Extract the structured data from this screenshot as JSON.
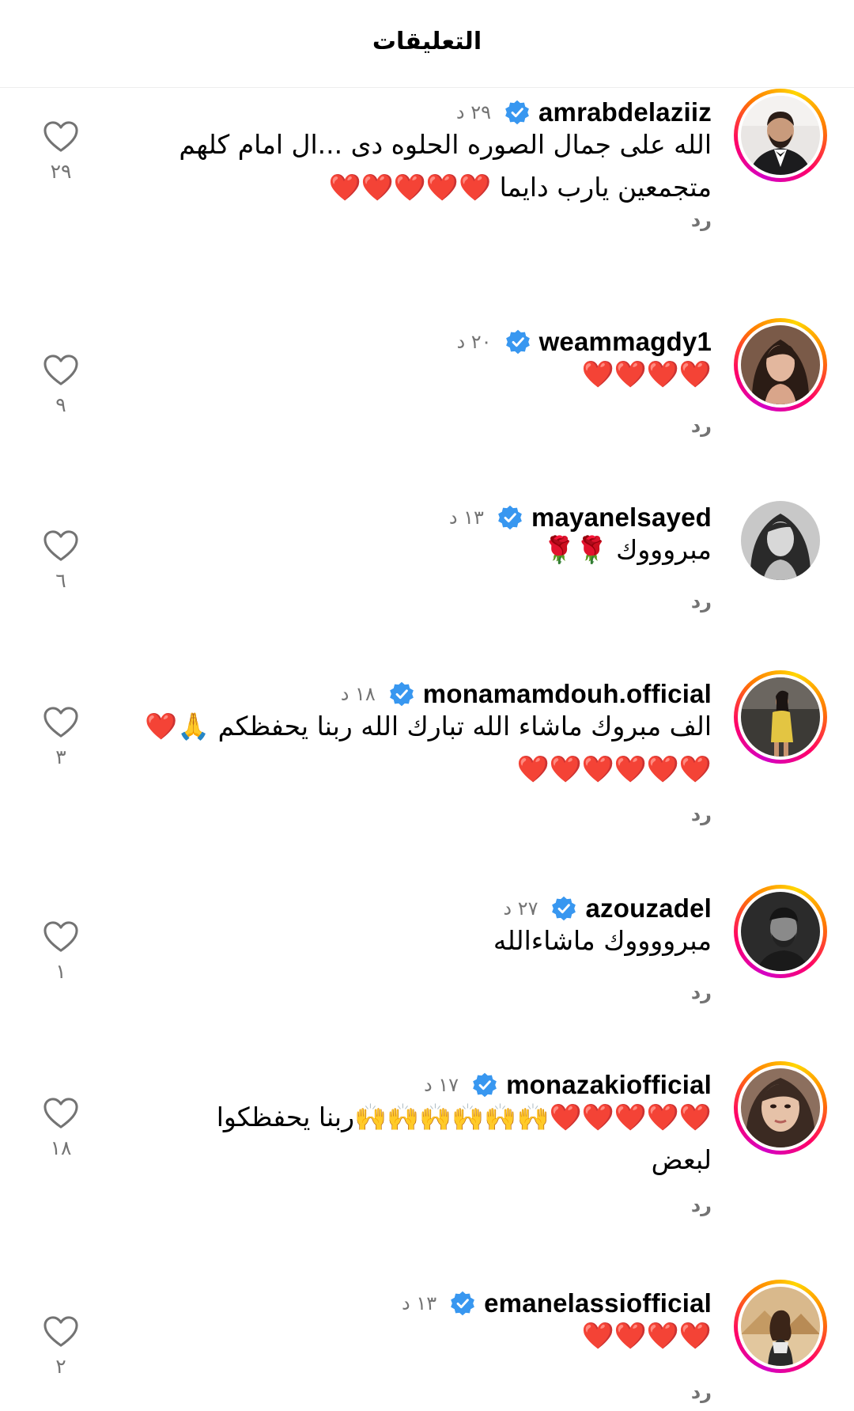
{
  "header": {
    "title": "التعليقات"
  },
  "reply_label": "رد",
  "colors": {
    "verified_blue": "#3897f0",
    "secondary_text": "#737373",
    "heart_red": "#e8222e"
  },
  "comments": [
    {
      "username": "amrabdelaziiz",
      "verified": true,
      "time": "٢٩ د",
      "text_lines": [
        "الله على جمال الصوره الحلوه دى ...ال امام كلهم",
        "متجمعين يارب دايما ❤️❤️❤️❤️❤️"
      ],
      "likes": "٢٩",
      "avatar_icon": "man-in-tuxedo-avatar",
      "story_ring": true
    },
    {
      "username": "weammagdy1",
      "verified": true,
      "time": "٢٠ د",
      "text_lines": [
        "❤️❤️❤️❤️"
      ],
      "likes": "٩",
      "avatar_icon": "woman-portrait-avatar",
      "story_ring": true
    },
    {
      "username": "mayanelsayed",
      "verified": true,
      "time": "١٣ د",
      "text_lines": [
        "مبروووك 🌹🌹"
      ],
      "likes": "٦",
      "avatar_icon": "woman-bw-portrait-avatar",
      "story_ring": false
    },
    {
      "username": "monamamdouh.official",
      "verified": true,
      "time": "١٨ د",
      "text_lines": [
        "الف مبروك ماشاء الله تبارك الله ربنا يحفظكم 🙏❤️",
        "❤️❤️❤️❤️❤️❤️"
      ],
      "likes": "٣",
      "avatar_icon": "woman-yellow-dress-avatar",
      "story_ring": true
    },
    {
      "username": "azouzadel",
      "verified": true,
      "time": "٢٧ د",
      "text_lines": [
        "مبرووووك ماشاءالله"
      ],
      "likes": "١",
      "avatar_icon": "man-bw-portrait-avatar",
      "story_ring": true
    },
    {
      "username": "monazakiofficial",
      "verified": true,
      "time": "١٧ د",
      "text_lines": [
        "❤️❤️❤️❤️❤️🙌🙌🙌🙌🙌🙌ربنا يحفظكوا",
        "لبعض"
      ],
      "likes": "١٨",
      "avatar_icon": "woman-closeup-avatar",
      "story_ring": true
    },
    {
      "username": "emanelassiofficial",
      "verified": true,
      "time": "١٣ د",
      "text_lines": [
        "❤️❤️❤️❤️"
      ],
      "likes": "٢",
      "avatar_icon": "woman-desert-avatar",
      "story_ring": true
    }
  ]
}
